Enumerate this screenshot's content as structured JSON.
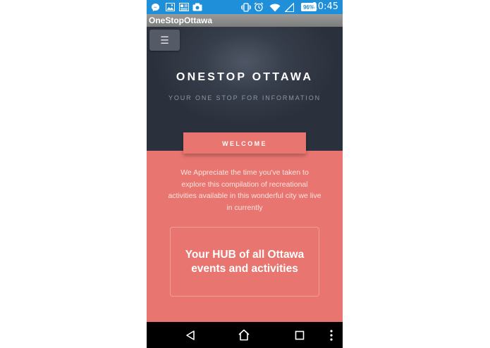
{
  "status_bar": {
    "icons": [
      "messenger-icon",
      "gallery-icon",
      "news-icon",
      "camera-icon",
      "vibrate-icon",
      "alarm-icon",
      "wifi-icon",
      "signal-icon"
    ],
    "battery": "96%",
    "time": "10:45",
    "color": "#1e8fd8"
  },
  "app": {
    "title": "OneStopOttawa"
  },
  "header": {
    "menu_icon": "☰",
    "title": "ONESTOP OTTAWA",
    "subtitle": "YOUR ONE STOP FOR INFORMATION"
  },
  "welcome": {
    "tab_label": "WELCOME",
    "intro": "We Appreciate the time you've taken to explore this compilation of recreational activities available in this wonderful city we live in currently",
    "hub_text": "Your HUB of all Ottawa events and activities",
    "accent_color": "#e8756f"
  },
  "nav_bar": {
    "buttons": [
      "back-icon",
      "home-icon",
      "recents-icon",
      "overflow-icon"
    ]
  }
}
